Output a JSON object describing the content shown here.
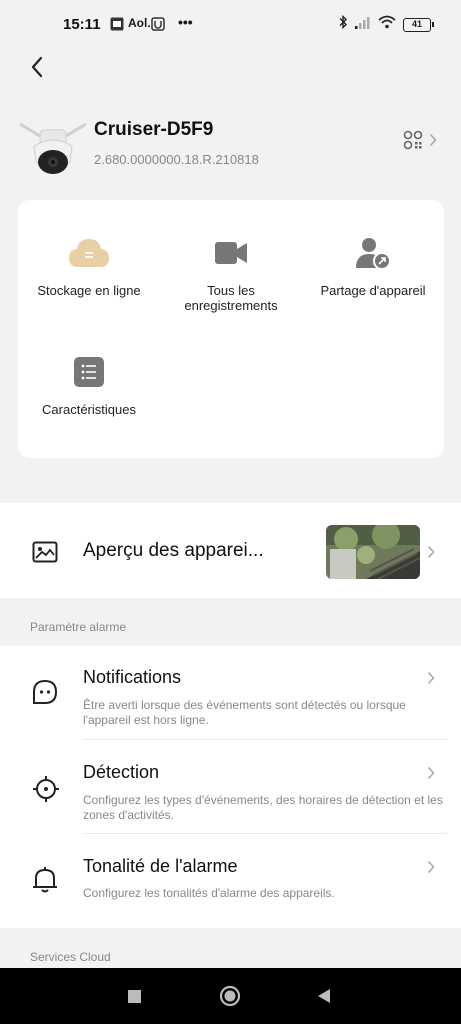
{
  "status_bar": {
    "time": "15:11",
    "battery": "41",
    "icons": [
      "notification-app-icon",
      "aol-icon",
      "app-icon",
      "more-icon",
      "bluetooth-icon",
      "signal-icon",
      "wifi-icon",
      "battery-icon"
    ],
    "aol_label": "Aol.",
    "more": "•••"
  },
  "header": {
    "back_icon": "chevron-left-icon"
  },
  "device": {
    "name": "Cruiser-D5F9",
    "version": "2.680.0000000.18.R.210818",
    "qr_icon": "qr-code-icon"
  },
  "features": [
    {
      "label": "Stockage en ligne",
      "icon": "cloud-icon",
      "color": "#e8cfa6"
    },
    {
      "label": "Tous les enregistrements",
      "icon": "video-camera-icon",
      "color": "#777777"
    },
    {
      "label": "Partage d'appareil",
      "icon": "share-user-icon",
      "color": "#777777"
    },
    {
      "label": "Caractéristiques",
      "icon": "list-icon",
      "color": "#777777"
    }
  ],
  "preview": {
    "label": "Aperçu des apparei...",
    "icon": "image-icon"
  },
  "alarm_section": {
    "header": "Paramètre alarme",
    "items": [
      {
        "title": "Notifications",
        "description": "Être averti lorsque des événements sont détectés ou lorsque l'appareil est hors ligne.",
        "icon": "chat-bubble-icon"
      },
      {
        "title": "Détection",
        "description": "Configurez les types d'événements, des horaires de détection et les zones d'activités.",
        "icon": "crosshair-icon"
      },
      {
        "title": "Tonalité de l'alarme",
        "description": "Configurez les tonalités d'alarme des appareils.",
        "icon": "bell-icon"
      }
    ]
  },
  "cloud_section": {
    "header": "Services Cloud"
  },
  "nav_bar": {
    "buttons": [
      "recents-square-icon",
      "home-circle-icon",
      "back-triangle-icon"
    ]
  }
}
